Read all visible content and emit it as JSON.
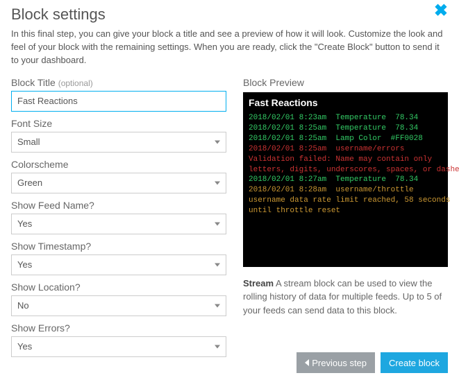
{
  "header": {
    "title": "Block settings",
    "close_icon": "close-icon"
  },
  "description": "In this final step, you can give your block a title and see a preview of how it will look. Customize the look and feel of your block with the remaining settings. When you are ready, click the \"Create Block\" button to send it to your dashboard.",
  "form": {
    "block_title_label": "Block Title",
    "block_title_optional": "(optional)",
    "block_title_value": "Fast Reactions",
    "font_size_label": "Font Size",
    "font_size_value": "Small",
    "colorscheme_label": "Colorscheme",
    "colorscheme_value": "Green",
    "show_feed_label": "Show Feed Name?",
    "show_feed_value": "Yes",
    "show_timestamp_label": "Show Timestamp?",
    "show_timestamp_value": "Yes",
    "show_location_label": "Show Location?",
    "show_location_value": "No",
    "show_errors_label": "Show Errors?",
    "show_errors_value": "Yes"
  },
  "preview": {
    "label": "Block Preview",
    "title": "Fast Reactions",
    "lines": [
      {
        "cls": "g",
        "text": "2018/02/01 8:23am  Temperature  78.34"
      },
      {
        "cls": "g",
        "text": "2018/02/01 8:25am  Temperature  78.34"
      },
      {
        "cls": "g",
        "text": "2018/02/01 8:25am  Lamp Color  #FF0028"
      },
      {
        "cls": "r",
        "text": "2018/02/01 8:25am  username/errors"
      },
      {
        "cls": "r",
        "text": "Validation failed: Name may contain only"
      },
      {
        "cls": "r",
        "text": "letters, digits, underscores, spaces, or dashes"
      },
      {
        "cls": "g",
        "text": "2018/02/01 8:27am  Temperature  78.34"
      },
      {
        "cls": "y",
        "text": "2018/02/01 8:28am  username/throttle"
      },
      {
        "cls": "y",
        "text": "username data rate limit reached, 58 seconds"
      },
      {
        "cls": "y",
        "text": "until throttle reset"
      }
    ],
    "caption_bold": "Stream",
    "caption_rest": " A stream block can be used to view the rolling history of data for multiple feeds. Up to 5 of your feeds can send data to this block."
  },
  "footer": {
    "prev": "Previous step",
    "create": "Create block"
  }
}
